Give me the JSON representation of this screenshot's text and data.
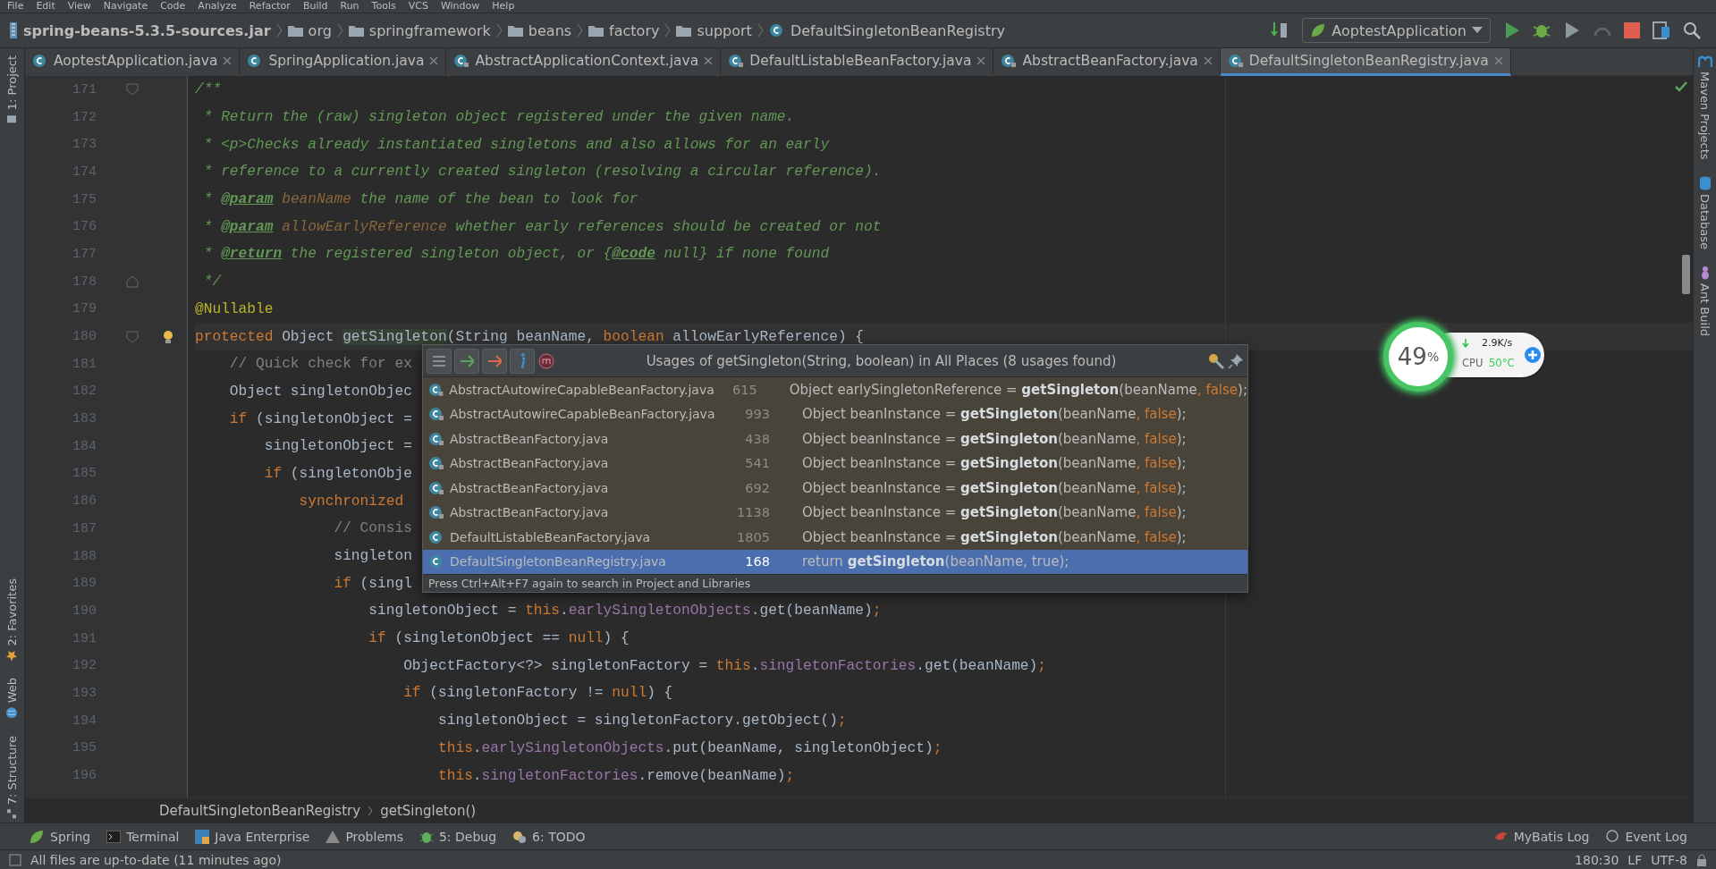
{
  "menu": [
    "File",
    "Edit",
    "View",
    "Navigate",
    "Code",
    "Analyze",
    "Refactor",
    "Build",
    "Run",
    "Tools",
    "VCS",
    "Window",
    "Help"
  ],
  "nav": {
    "items": [
      {
        "kind": "jar",
        "label": "spring-beans-5.3.5-sources.jar"
      },
      {
        "kind": "folder",
        "label": "org"
      },
      {
        "kind": "folder",
        "label": "springframework"
      },
      {
        "kind": "folder",
        "label": "beans"
      },
      {
        "kind": "folder",
        "label": "factory"
      },
      {
        "kind": "folder",
        "label": "support"
      },
      {
        "kind": "class",
        "label": "DefaultSingletonBeanRegistry"
      }
    ],
    "run_config": "AoptestApplication"
  },
  "left_tools": [
    "1: Project",
    "2: Favorites",
    "Web",
    "7: Structure"
  ],
  "right_tools": [
    "Maven Projects",
    "Database",
    "Ant Build"
  ],
  "tabs": [
    {
      "label": "AoptestApplication.java",
      "selected": false
    },
    {
      "label": "SpringApplication.java",
      "selected": false
    },
    {
      "label": "AbstractApplicationContext.java",
      "selected": false
    },
    {
      "label": "DefaultListableBeanFactory.java",
      "selected": false
    },
    {
      "label": "AbstractBeanFactory.java",
      "selected": false
    },
    {
      "label": "DefaultSingletonBeanRegistry.java",
      "selected": true
    }
  ],
  "editor": {
    "lines": [
      {
        "number": "171",
        "fold_open": true,
        "current": false,
        "tokens": [
          {
            "text": "/**",
            "kind": "doc"
          }
        ]
      },
      {
        "number": "172",
        "current": false,
        "tokens": [
          {
            "text": " * Return the (raw) singleton object registered under the given name.",
            "kind": "doc"
          }
        ]
      },
      {
        "number": "173",
        "current": false,
        "tokens": [
          {
            "text": " * <p>Checks already instantiated singletons and also allows for an early",
            "kind": "doc"
          }
        ]
      },
      {
        "number": "174",
        "current": false,
        "tokens": [
          {
            "text": " * reference to a currently created singleton (resolving a circular reference).",
            "kind": "doc"
          }
        ]
      },
      {
        "number": "175",
        "current": false,
        "tokens": [
          {
            "text": " * ",
            "kind": "doc"
          },
          {
            "text": "@param",
            "kind": "doctag"
          },
          {
            "text": " beanName",
            "kind": "docparam"
          },
          {
            "text": " the name of the bean to look for",
            "kind": "doc"
          }
        ]
      },
      {
        "number": "176",
        "current": false,
        "tokens": [
          {
            "text": " * ",
            "kind": "doc"
          },
          {
            "text": "@param",
            "kind": "doctag"
          },
          {
            "text": " allowEarlyReference",
            "kind": "docparam"
          },
          {
            "text": " whether early references should be created or not",
            "kind": "doc"
          }
        ]
      },
      {
        "number": "177",
        "current": false,
        "tokens": [
          {
            "text": " * ",
            "kind": "doc"
          },
          {
            "text": "@return",
            "kind": "doctag"
          },
          {
            "text": " the registered singleton object, or {",
            "kind": "doc"
          },
          {
            "text": "@code",
            "kind": "doctag"
          },
          {
            "text": " null} if none found",
            "kind": "doc"
          }
        ]
      },
      {
        "number": "178",
        "fold_close": true,
        "current": false,
        "tokens": [
          {
            "text": " */",
            "kind": "doc"
          }
        ]
      },
      {
        "number": "179",
        "current": false,
        "tokens": [
          {
            "text": "@Nullable",
            "kind": "annotation"
          }
        ]
      },
      {
        "number": "180",
        "fold_open": true,
        "current": true,
        "tokens": [
          {
            "text": "protected ",
            "kind": "keyword"
          },
          {
            "text": "Object ",
            "kind": "plain"
          },
          {
            "text": "getSingleton",
            "kind": "usage"
          },
          {
            "text": "(String beanName, ",
            "kind": "plain"
          },
          {
            "text": "boolean ",
            "kind": "keyword"
          },
          {
            "text": "allowEarlyReference) {",
            "kind": "plain"
          }
        ]
      },
      {
        "number": "181",
        "current": false,
        "tokens": [
          {
            "text": "    // Quick check for ex",
            "kind": "comment"
          }
        ]
      },
      {
        "number": "182",
        "current": false,
        "tokens": [
          {
            "text": "    Object singletonObjec",
            "kind": "plain"
          }
        ]
      },
      {
        "number": "183",
        "current": false,
        "tokens": [
          {
            "text": "    if",
            "kind": "keyword"
          },
          {
            "text": " (singletonObject =",
            "kind": "plain"
          }
        ]
      },
      {
        "number": "184",
        "current": false,
        "tokens": [
          {
            "text": "        singletonObject =",
            "kind": "plain"
          }
        ]
      },
      {
        "number": "185",
        "current": false,
        "tokens": [
          {
            "text": "        if",
            "kind": "keyword"
          },
          {
            "text": " (singletonObje",
            "kind": "plain"
          }
        ]
      },
      {
        "number": "186",
        "current": false,
        "tokens": [
          {
            "text": "            synchronized",
            "kind": "keyword"
          }
        ]
      },
      {
        "number": "187",
        "current": false,
        "tokens": [
          {
            "text": "                // Consis",
            "kind": "comment"
          }
        ]
      },
      {
        "number": "188",
        "current": false,
        "tokens": [
          {
            "text": "                singleton",
            "kind": "plain"
          }
        ]
      },
      {
        "number": "189",
        "current": false,
        "tokens": [
          {
            "text": "                if",
            "kind": "keyword"
          },
          {
            "text": " (singl",
            "kind": "plain"
          }
        ]
      },
      {
        "number": "190",
        "current": false,
        "tokens": [
          {
            "text": "                    singletonObject = ",
            "kind": "plain"
          },
          {
            "text": "this",
            "kind": "keyword"
          },
          {
            "text": ".",
            "kind": "plain"
          },
          {
            "text": "earlySingletonObjects",
            "kind": "field"
          },
          {
            "text": ".get(beanName)",
            "kind": "plain"
          },
          {
            "text": ";",
            "kind": "keyword"
          }
        ]
      },
      {
        "number": "191",
        "current": false,
        "tokens": [
          {
            "text": "                    if",
            "kind": "keyword"
          },
          {
            "text": " (singletonObject == ",
            "kind": "plain"
          },
          {
            "text": "null",
            "kind": "keyword"
          },
          {
            "text": ") {",
            "kind": "plain"
          }
        ]
      },
      {
        "number": "192",
        "current": false,
        "tokens": [
          {
            "text": "                        ObjectFactory<?> singletonFactory = ",
            "kind": "plain"
          },
          {
            "text": "this",
            "kind": "keyword"
          },
          {
            "text": ".",
            "kind": "plain"
          },
          {
            "text": "singletonFactories",
            "kind": "field"
          },
          {
            "text": ".get(beanName)",
            "kind": "plain"
          },
          {
            "text": ";",
            "kind": "keyword"
          }
        ]
      },
      {
        "number": "193",
        "current": false,
        "tokens": [
          {
            "text": "                        if",
            "kind": "keyword"
          },
          {
            "text": " (singletonFactory != ",
            "kind": "plain"
          },
          {
            "text": "null",
            "kind": "keyword"
          },
          {
            "text": ") {",
            "kind": "plain"
          }
        ]
      },
      {
        "number": "194",
        "current": false,
        "tokens": [
          {
            "text": "                            singletonObject = singletonFactory.getObject()",
            "kind": "plain"
          },
          {
            "text": ";",
            "kind": "keyword"
          }
        ]
      },
      {
        "number": "195",
        "current": false,
        "tokens": [
          {
            "text": "                            this",
            "kind": "keyword"
          },
          {
            "text": ".",
            "kind": "plain"
          },
          {
            "text": "earlySingletonObjects",
            "kind": "field"
          },
          {
            "text": ".put(beanName, singletonObject)",
            "kind": "plain"
          },
          {
            "text": ";",
            "kind": "keyword"
          }
        ]
      },
      {
        "number": "196",
        "current": false,
        "tokens": [
          {
            "text": "                            this",
            "kind": "keyword"
          },
          {
            "text": ".",
            "kind": "plain"
          },
          {
            "text": "singletonFactories",
            "kind": "field"
          },
          {
            "text": ".remove(beanName)",
            "kind": "plain"
          },
          {
            "text": ";",
            "kind": "keyword"
          }
        ]
      }
    ]
  },
  "popup": {
    "title": "Usages of getSingleton(String, boolean) in All Places (8 usages found)",
    "rows": [
      {
        "file": "AbstractAutowireCapableBeanFactory.java",
        "line": "615",
        "selected": false,
        "segments": [
          {
            "text": "Object earlySingletonReference = ",
            "kind": "plain"
          },
          {
            "text": "getSingleton",
            "kind": "match"
          },
          {
            "text": "(beanName",
            "kind": "plain"
          },
          {
            "text": ", false",
            "kind": "keyword"
          },
          {
            "text": ");",
            "kind": "plain"
          }
        ]
      },
      {
        "file": "AbstractAutowireCapableBeanFactory.java",
        "line": "993",
        "selected": false,
        "segments": [
          {
            "text": "Object beanInstance = ",
            "kind": "plain"
          },
          {
            "text": "getSingleton",
            "kind": "match"
          },
          {
            "text": "(beanName",
            "kind": "plain"
          },
          {
            "text": ", false",
            "kind": "keyword"
          },
          {
            "text": ");",
            "kind": "plain"
          }
        ]
      },
      {
        "file": "AbstractBeanFactory.java",
        "line": "438",
        "selected": false,
        "segments": [
          {
            "text": "Object beanInstance = ",
            "kind": "plain"
          },
          {
            "text": "getSingleton",
            "kind": "match"
          },
          {
            "text": "(beanName",
            "kind": "plain"
          },
          {
            "text": ", false",
            "kind": "keyword"
          },
          {
            "text": ");",
            "kind": "plain"
          }
        ]
      },
      {
        "file": "AbstractBeanFactory.java",
        "line": "541",
        "selected": false,
        "segments": [
          {
            "text": "Object beanInstance = ",
            "kind": "plain"
          },
          {
            "text": "getSingleton",
            "kind": "match"
          },
          {
            "text": "(beanName",
            "kind": "plain"
          },
          {
            "text": ", false",
            "kind": "keyword"
          },
          {
            "text": ");",
            "kind": "plain"
          }
        ]
      },
      {
        "file": "AbstractBeanFactory.java",
        "line": "692",
        "selected": false,
        "segments": [
          {
            "text": "Object beanInstance = ",
            "kind": "plain"
          },
          {
            "text": "getSingleton",
            "kind": "match"
          },
          {
            "text": "(beanName",
            "kind": "plain"
          },
          {
            "text": ", false",
            "kind": "keyword"
          },
          {
            "text": ");",
            "kind": "plain"
          }
        ]
      },
      {
        "file": "AbstractBeanFactory.java",
        "line": "1138",
        "selected": false,
        "segments": [
          {
            "text": "Object beanInstance = ",
            "kind": "plain"
          },
          {
            "text": "getSingleton",
            "kind": "match"
          },
          {
            "text": "(beanName",
            "kind": "plain"
          },
          {
            "text": ", false",
            "kind": "keyword"
          },
          {
            "text": ");",
            "kind": "plain"
          }
        ]
      },
      {
        "file": "DefaultListableBeanFactory.java",
        "line": "1805",
        "selected": false,
        "segments": [
          {
            "text": "Object beanInstance = ",
            "kind": "plain"
          },
          {
            "text": "getSingleton",
            "kind": "match"
          },
          {
            "text": "(beanName",
            "kind": "plain"
          },
          {
            "text": ", false",
            "kind": "keyword"
          },
          {
            "text": ");",
            "kind": "plain"
          }
        ]
      },
      {
        "file": "DefaultSingletonBeanRegistry.java",
        "line": "168",
        "selected": true,
        "segments": [
          {
            "text": "return ",
            "kind": "plain"
          },
          {
            "text": "getSingleton",
            "kind": "match"
          },
          {
            "text": "(beanName, true);",
            "kind": "plain"
          }
        ]
      }
    ],
    "footer": "Press Ctrl+Alt+F7 again to search in Project and Libraries"
  },
  "monitor": {
    "percent": "49",
    "unit": "%",
    "speed": "2.9K/s",
    "cpu_label": "CPU",
    "temp": "50°C"
  },
  "breadcrumbs": [
    "DefaultSingletonBeanRegistry",
    "getSingleton()"
  ],
  "tool_windows": [
    "Spring",
    "Terminal",
    "Java Enterprise",
    "Problems",
    "5: Debug",
    "6: TODO"
  ],
  "tool_windows_right": [
    "MyBatis Log",
    "Event Log"
  ],
  "status": {
    "message": "All files are up-to-date (11 minutes ago)",
    "position": "180:30",
    "line_ending": "LF",
    "encoding": "UTF-8"
  }
}
